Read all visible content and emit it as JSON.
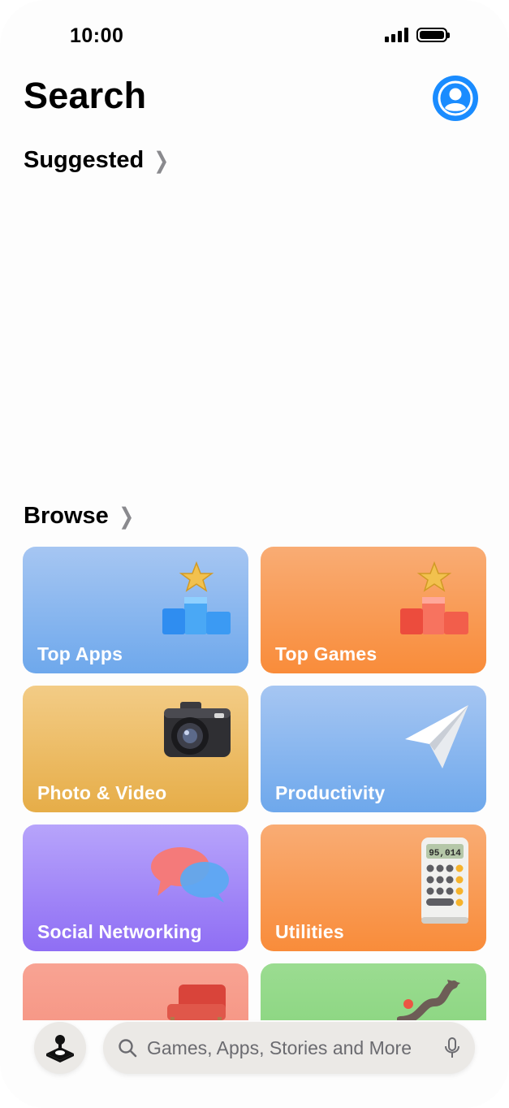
{
  "status_bar": {
    "time": "10:00"
  },
  "header": {
    "title": "Search",
    "account_icon": "person-circle-icon"
  },
  "suggested": {
    "label": "Suggested"
  },
  "browse": {
    "label": "Browse",
    "categories": [
      {
        "label": "Top Apps",
        "icon": "podium-star-blue-icon"
      },
      {
        "label": "Top Games",
        "icon": "podium-star-red-icon"
      },
      {
        "label": "Photo & Video",
        "icon": "camera-icon"
      },
      {
        "label": "Productivity",
        "icon": "paper-plane-icon"
      },
      {
        "label": "Social Networking",
        "icon": "speech-bubbles-icon"
      },
      {
        "label": "Utilities",
        "icon": "calculator-icon",
        "display": "95,014"
      },
      {
        "label": "",
        "icon": "armchair-icon"
      },
      {
        "label": "",
        "icon": "winding-path-icon"
      }
    ]
  },
  "bottom_bar": {
    "arcade_icon": "joystick-icon",
    "search_placeholder": "Games, Apps, Stories and More"
  },
  "colors": {
    "accent": "#1a8cff"
  }
}
